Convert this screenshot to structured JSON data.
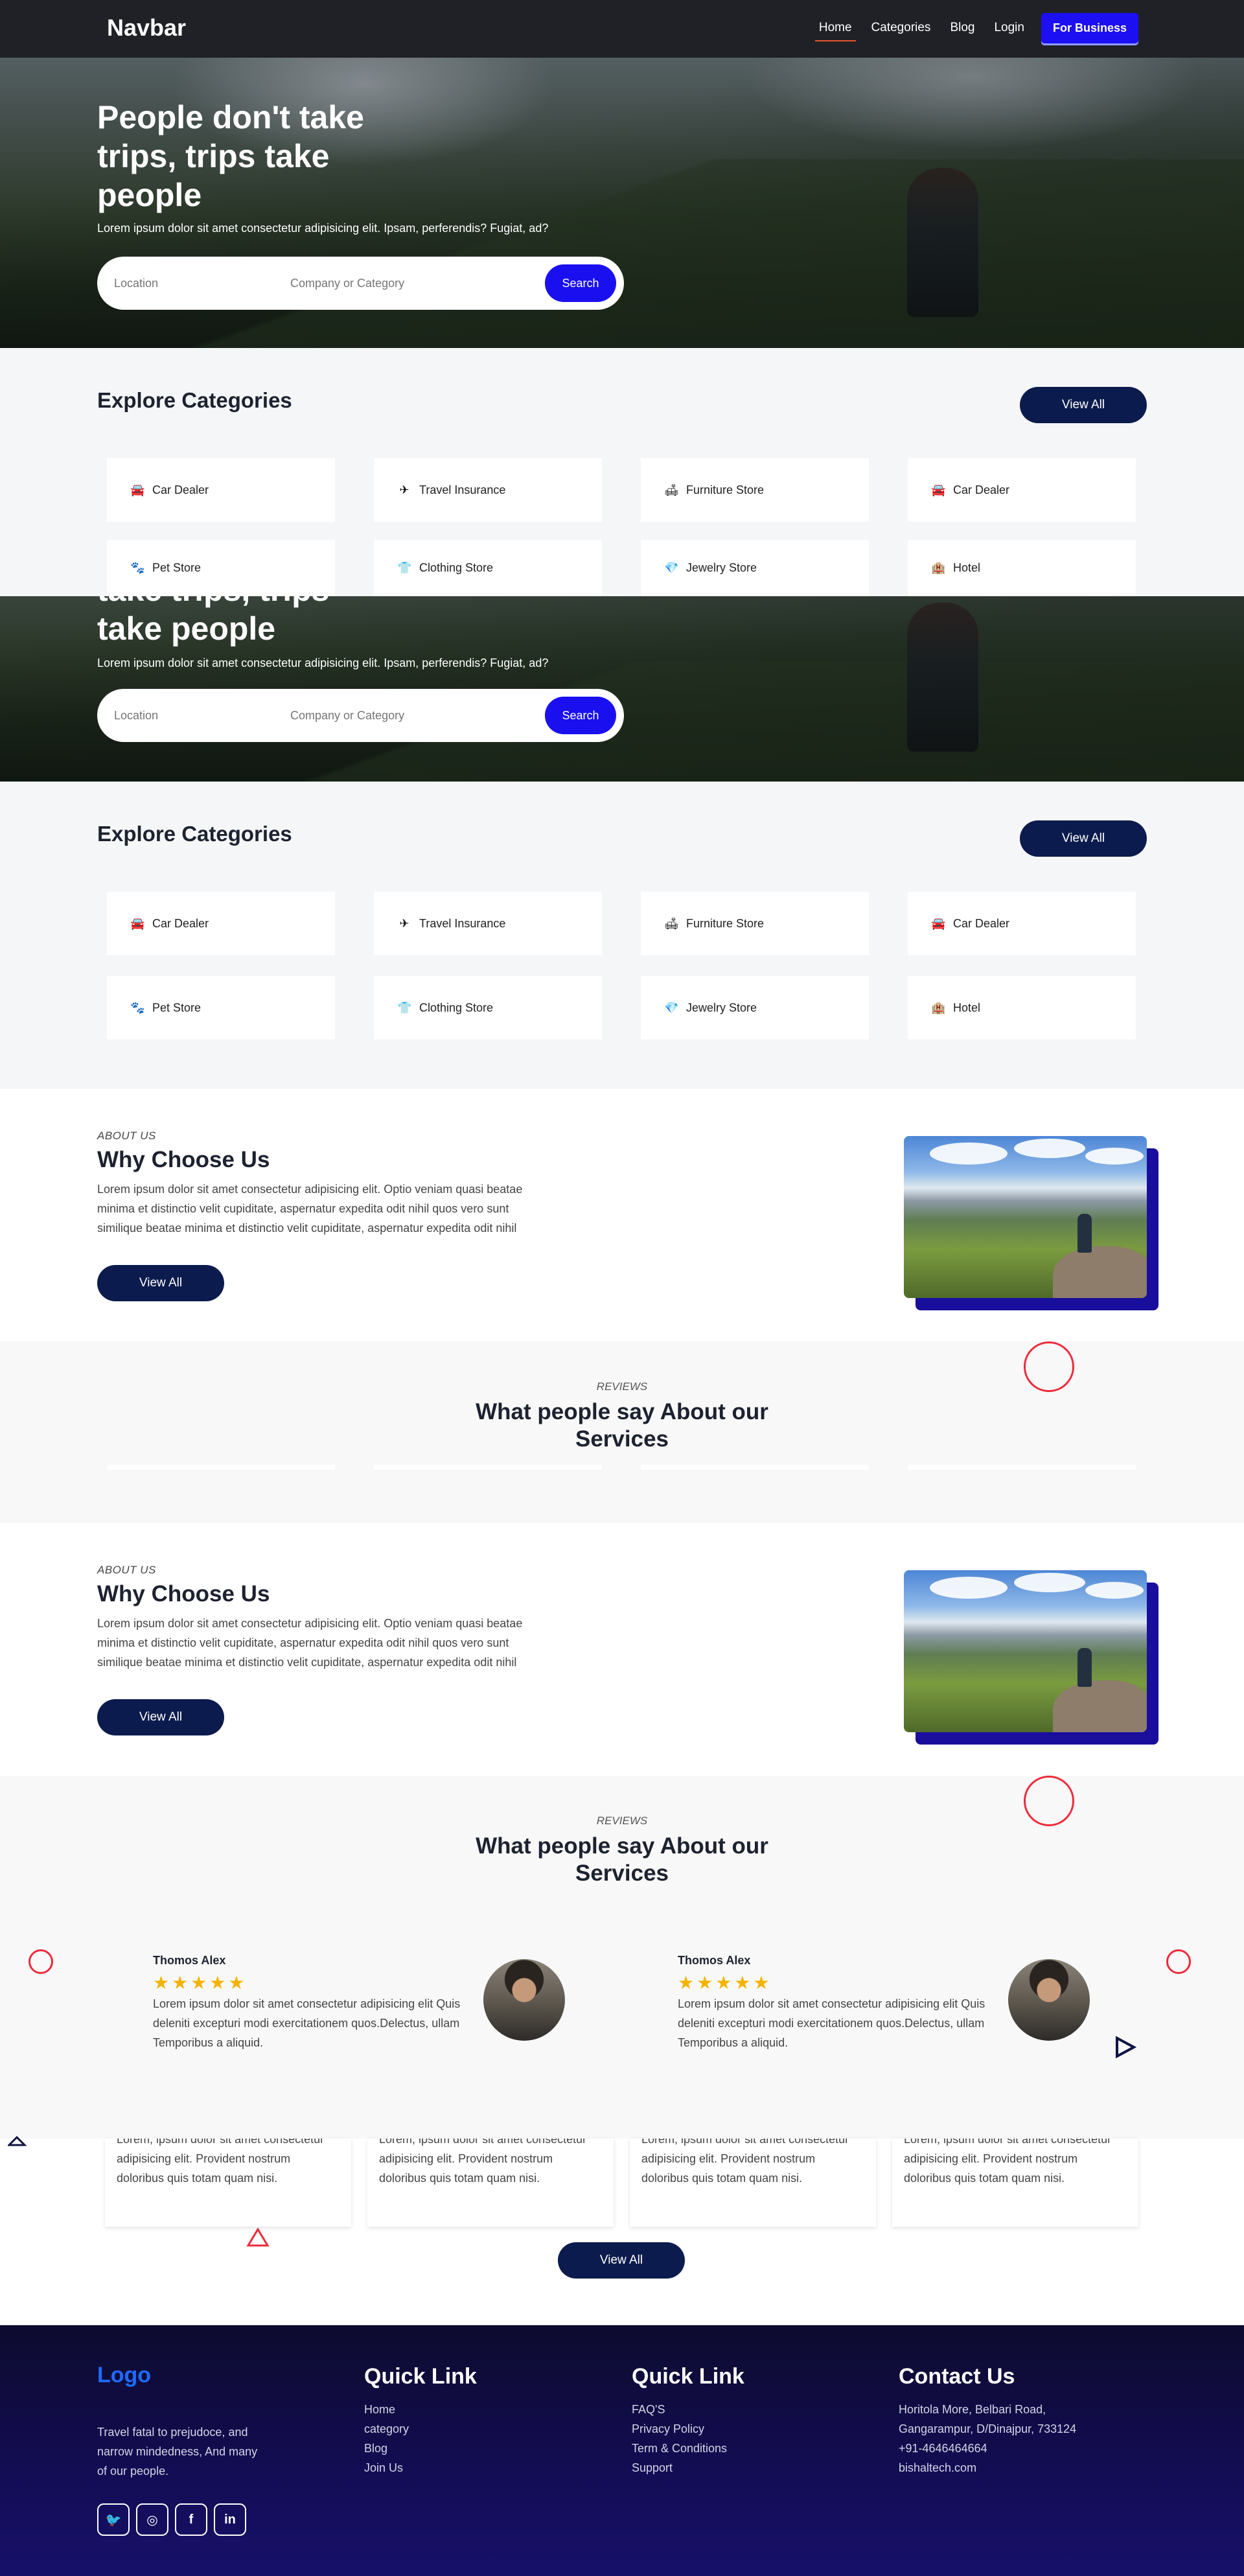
{
  "navbar": {
    "brand": "Navbar",
    "links": [
      "Home",
      "Categories",
      "Blog",
      "Login"
    ],
    "business_label": "For Business"
  },
  "hero": {
    "title": "People don't take trips, trips take people",
    "title_visible_second": "take trips, trips take people",
    "subtitle": "Lorem ipsum dolor sit amet consectetur adipisicing elit. Ipsam, perferendis? Fugiat, ad?",
    "location_placeholder": "Location",
    "category_placeholder": "Company or Category",
    "search_label": "Search"
  },
  "categories": {
    "title": "Explore Categories",
    "view_all": "View All",
    "items": [
      {
        "label": "Car Dealer",
        "icon": "car-icon"
      },
      {
        "label": "Travel Insurance",
        "icon": "airplane-icon"
      },
      {
        "label": "Furniture Store",
        "icon": "sofa-icon"
      },
      {
        "label": "Car Dealer",
        "icon": "car-icon"
      },
      {
        "label": "Pet Store",
        "icon": "paw-icon"
      },
      {
        "label": "Clothing Store",
        "icon": "tshirt-icon"
      },
      {
        "label": "Jewelry Store",
        "icon": "gem-icon"
      },
      {
        "label": "Hotel",
        "icon": "hotel-icon"
      }
    ]
  },
  "about": {
    "eyebrow": "ABOUT US",
    "title": "Why Choose Us",
    "text": "Lorem ipsum dolor sit amet consectetur adipisicing elit. Optio veniam quasi beatae minima et distinctio velit cupiditate, aspernatur expedita odit nihil quos vero sunt similique beatae minima et distinctio velit cupiditate, aspernatur expedita odit nihil",
    "view_all": "View All"
  },
  "reviews": {
    "eyebrow": "REVIEWS",
    "title": "What people say About our Services",
    "items": [
      {
        "name": "Thomos Alex",
        "stars": "★★★★★",
        "text": "Lorem ipsum dolor sit amet consectetur adipisicing elit Quis deleniti excepturi modi exercitationem quos.Delectus, ullam Temporibus a aliquid."
      },
      {
        "name": "Thomos Alex",
        "stars": "★★★★★",
        "text": "Lorem ipsum dolor sit amet consectetur adipisicing elit Quis deleniti excepturi modi exercitationem quos.Delectus, ullam Temporibus a aliquid."
      }
    ]
  },
  "testimonial_cards": {
    "text": "Lorem, ipsum dolor sit amet consectetur adipisicing elit. Provident nostrum doloribus quis totam quam nisi.",
    "view_all": "View All"
  },
  "footer": {
    "logo": "Logo",
    "tagline": "Travel fatal to prejudoce, and narrow mindedness, And many of our people.",
    "socials": [
      {
        "name": "twitter-icon",
        "glyph": "🐦"
      },
      {
        "name": "instagram-icon",
        "glyph": "◎"
      },
      {
        "name": "facebook-icon",
        "glyph": "f"
      },
      {
        "name": "linkedin-icon",
        "glyph": "in"
      }
    ],
    "quick_link_1": {
      "title": "Quick Link",
      "items": [
        "Home",
        "category",
        "Blog",
        "Join Us"
      ]
    },
    "quick_link_2": {
      "title": "Quick Link",
      "items": [
        "FAQ'S",
        "Privacy Policy",
        "Term & Conditions",
        "Support"
      ]
    },
    "contact": {
      "title": "Contact Us",
      "items": [
        "Horitola More, Belbari Road,",
        "Gangarampur, D/Dinajpur, 733124",
        "+91-4646464664",
        "bishaltech.com"
      ]
    }
  },
  "colors": {
    "accent": "#1a10ef",
    "navy": "#0c1b4d",
    "ring": "#ee2a3a",
    "star": "#f5b301"
  }
}
